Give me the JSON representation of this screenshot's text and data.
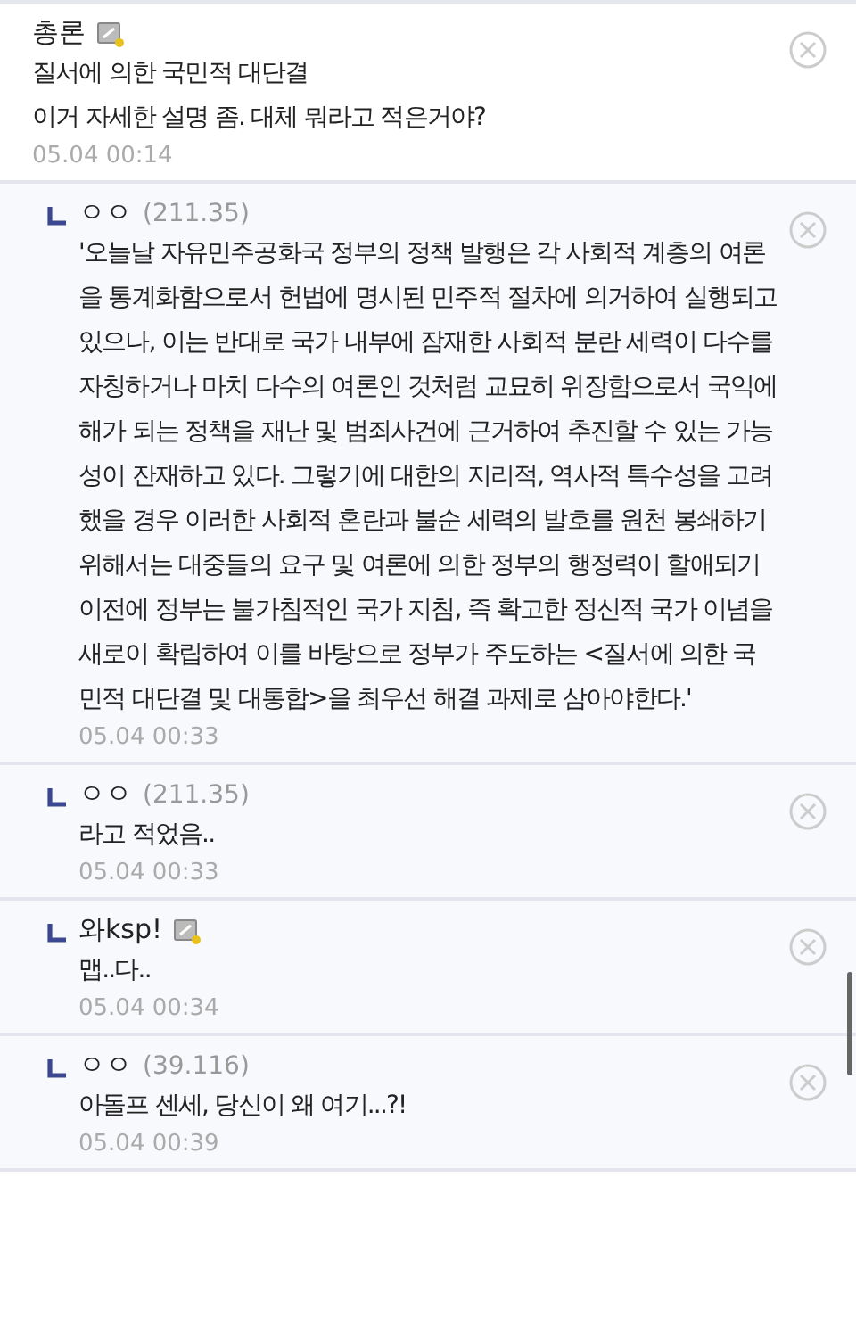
{
  "comments": [
    {
      "kind": "comment",
      "author": "총론",
      "member": true,
      "body": "질서에 의한 국민적 대단결\n이거 자세한 설명 좀. 대체 뭐라고 적은거야?",
      "time": "05.04 00:14"
    },
    {
      "kind": "reply",
      "author": "ㅇㅇ",
      "ip": "(211.35)",
      "member": false,
      "body": "'오늘날 자유민주공화국 정부의 정책 발행은 각 사회적 계층의 여론을 통계화함으로서 헌법에 명시된 민주적 절차에 의거하여 실행되고 있으나, 이는 반대로 국가 내부에 잠재한 사회적 분란 세력이 다수를 자칭하거나 마치 다수의 여론인 것처럼 교묘히 위장함으로서 국익에 해가 되는 정책을 재난 및 범죄사건에 근거하여 추진할 수 있는 가능성이 잔재하고 있다. 그렇기에 대한의 지리적, 역사적 특수성을 고려했을 경우 이러한 사회적 혼란과 불순 세력의 발호를 원천 봉쇄하기 위해서는 대중들의 요구 및 여론에 의한 정부의 행정력이 할애되기 이전에 정부는 불가침적인 국가 지침, 즉 확고한 정신적 국가 이념을 새로이 확립하여 이를 바탕으로 정부가 주도하는 <질서에 의한 국민적 대단결 및 대통합>을 최우선 해결 과제로 삼아야한다.'",
      "time": "05.04 00:33"
    },
    {
      "kind": "reply",
      "author": "ㅇㅇ",
      "ip": "(211.35)",
      "member": false,
      "body": "라고 적었음..",
      "time": "05.04 00:33"
    },
    {
      "kind": "reply",
      "author": "와ksp!",
      "member": true,
      "body": "맵..다..",
      "time": "05.04 00:34"
    },
    {
      "kind": "reply",
      "author": "ㅇㅇ",
      "ip": "(39.116)",
      "member": false,
      "body": "아돌프 센세, 당신이 왜 여기...?!",
      "time": "05.04 00:39"
    }
  ]
}
